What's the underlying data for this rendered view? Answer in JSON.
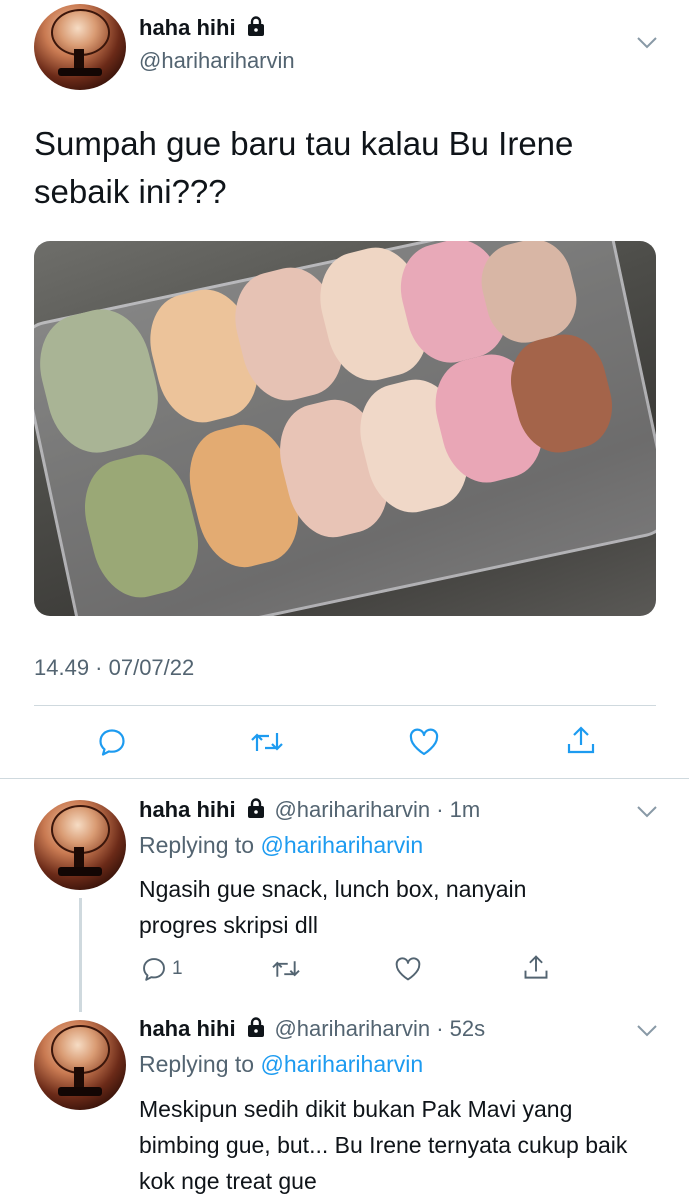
{
  "tweet": {
    "author_name": "haha hihi",
    "author_handle": "@harihariharvin",
    "text": "Sumpah gue baru tau kalau Bu Irene sebaik ini???",
    "timestamp": "14.49 · 07/07/22"
  },
  "replies": [
    {
      "author_name": "haha hihi",
      "author_handle": "@harihariharvin",
      "time": "1m",
      "replying_label": "Replying to",
      "replying_to": "@harihariharvin",
      "text": "Ngasih gue snack, lunch box, nanyain progres skripsi dll",
      "reply_count": "1"
    },
    {
      "author_name": "haha hihi",
      "author_handle": "@harihariharvin",
      "time": "52s",
      "replying_label": "Replying to",
      "replying_to": "@harihariharvin",
      "text": "Meskipun sedih dikit bukan Pak Mavi yang bimbing gue, but... Bu Irene ternyata cukup baik kok nge treat gue"
    }
  ],
  "icons": {
    "lock": "lock-icon",
    "chevron": "chevron-down-icon",
    "reply": "reply-icon",
    "retweet": "retweet-icon",
    "like": "like-icon",
    "share": "share-icon"
  },
  "colors": {
    "text": "#0f1419",
    "secondary": "#536471",
    "link": "#1d9bf0",
    "divider": "#cfd9de"
  }
}
